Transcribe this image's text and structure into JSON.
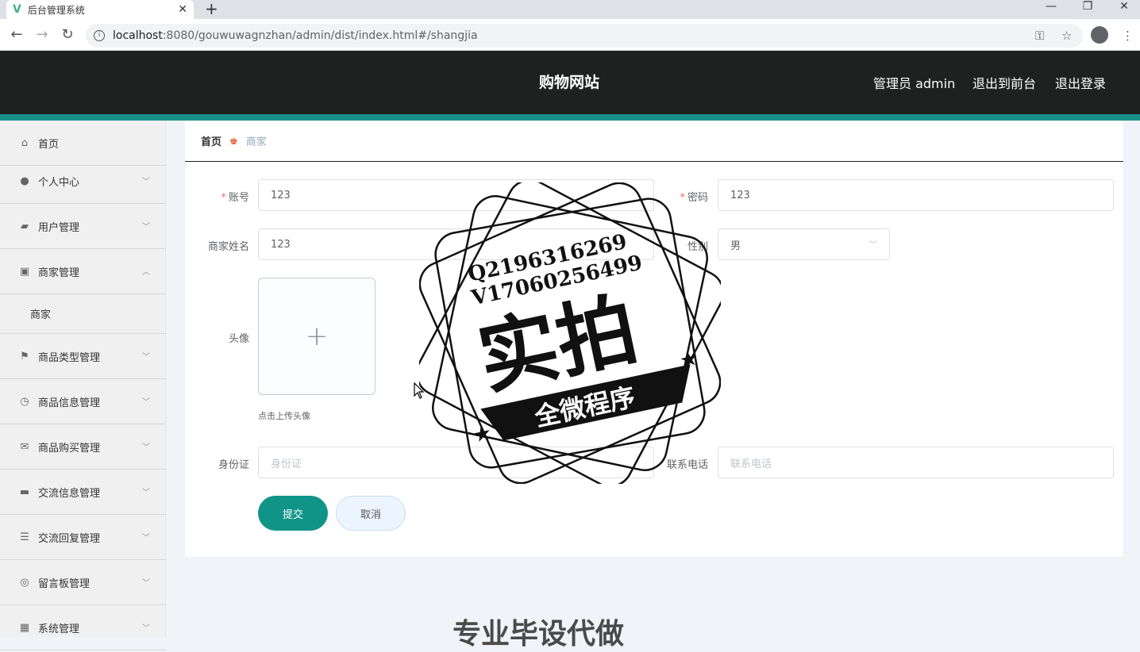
{
  "browser": {
    "tab_title": "后台管理系统",
    "new_tab": "+",
    "url_host": "localhost",
    "url_rest": ":8080/gouwuwagnzhan/admin/dist/index.html#/shangjia"
  },
  "header": {
    "site_title": "购物网站",
    "admin_label": "管理员 admin",
    "to_front": "退出到前台",
    "logout": "退出登录"
  },
  "sidebar": {
    "items": [
      {
        "label": "首页",
        "icon": "home-icon"
      },
      {
        "label": "个人中心",
        "icon": "user-icon"
      },
      {
        "label": "用户管理",
        "icon": "users-icon"
      },
      {
        "label": "商家管理",
        "icon": "wallet-icon"
      },
      {
        "label": "商品类型管理",
        "icon": "flag-icon"
      },
      {
        "label": "商品信息管理",
        "icon": "info-icon"
      },
      {
        "label": "商品购买管理",
        "icon": "mail-icon"
      },
      {
        "label": "交流信息管理",
        "icon": "chat-icon"
      },
      {
        "label": "交流回复管理",
        "icon": "sliders-icon"
      },
      {
        "label": "留言板管理",
        "icon": "lifebuoy-icon"
      },
      {
        "label": "系统管理",
        "icon": "grid-icon"
      }
    ],
    "sub_shangjia": "商家"
  },
  "breadcrumb": {
    "home": "首页",
    "current": "商家"
  },
  "form": {
    "account_label": "账号",
    "account_value": "123",
    "password_label": "密码",
    "password_value": "123",
    "name_label": "商家姓名",
    "name_value": "123",
    "gender_label": "性别",
    "gender_value": "男",
    "avatar_label": "头像",
    "upload_tip": "点击上传头像",
    "idcard_label": "身份证",
    "idcard_placeholder": "身份证",
    "phone_label": "联系电话",
    "phone_placeholder": "联系电话",
    "submit": "提交",
    "cancel": "取消"
  },
  "watermark": {
    "qq": "Q2196316269",
    "vx": "V17060256499",
    "main": "实拍",
    "ribbon": "全微程序",
    "bottom": "专业毕设代做"
  }
}
